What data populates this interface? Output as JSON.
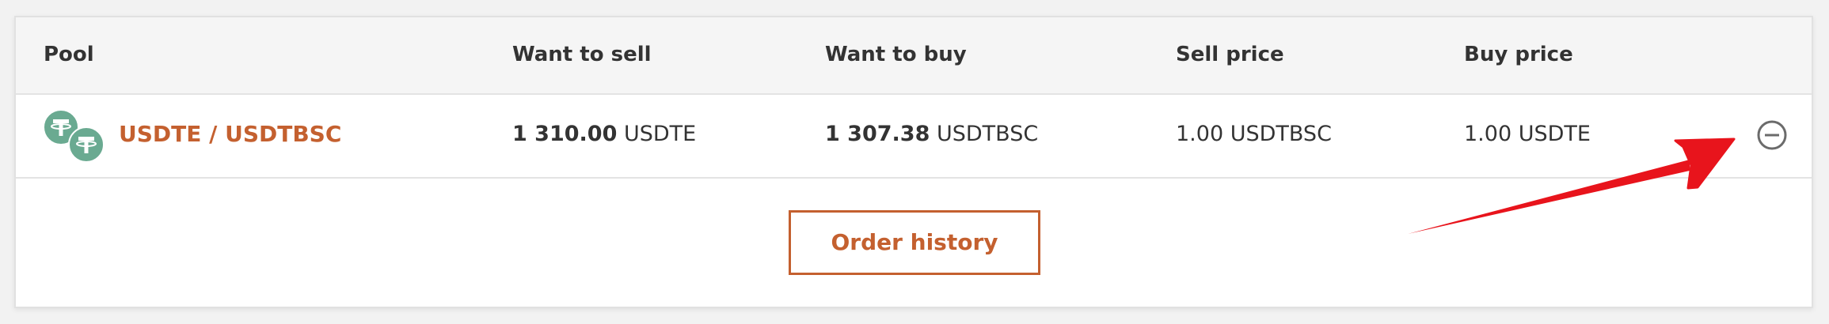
{
  "table": {
    "headers": {
      "pool": "Pool",
      "want_to_sell": "Want to sell",
      "want_to_buy": "Want to buy",
      "sell_price": "Sell price",
      "buy_price": "Buy price"
    },
    "rows": [
      {
        "pool": "USDTE / USDTBSC",
        "want_to_sell_amount": "1 310.00",
        "want_to_sell_unit": "USDTE",
        "want_to_buy_amount": "1 307.38",
        "want_to_buy_unit": "USDTBSC",
        "sell_price": "1.00 USDTBSC",
        "buy_price": "1.00 USDTE"
      }
    ]
  },
  "actions": {
    "order_history_label": "Order history"
  },
  "icons": {
    "coin_primary": "tether-icon",
    "coin_secondary": "tether-icon",
    "remove": "minus-circle-icon",
    "annotation": "red-arrow-annotation"
  },
  "colors": {
    "accent": "#c4602f",
    "coin": "#6aaa91",
    "annotation": "#e8141c"
  }
}
